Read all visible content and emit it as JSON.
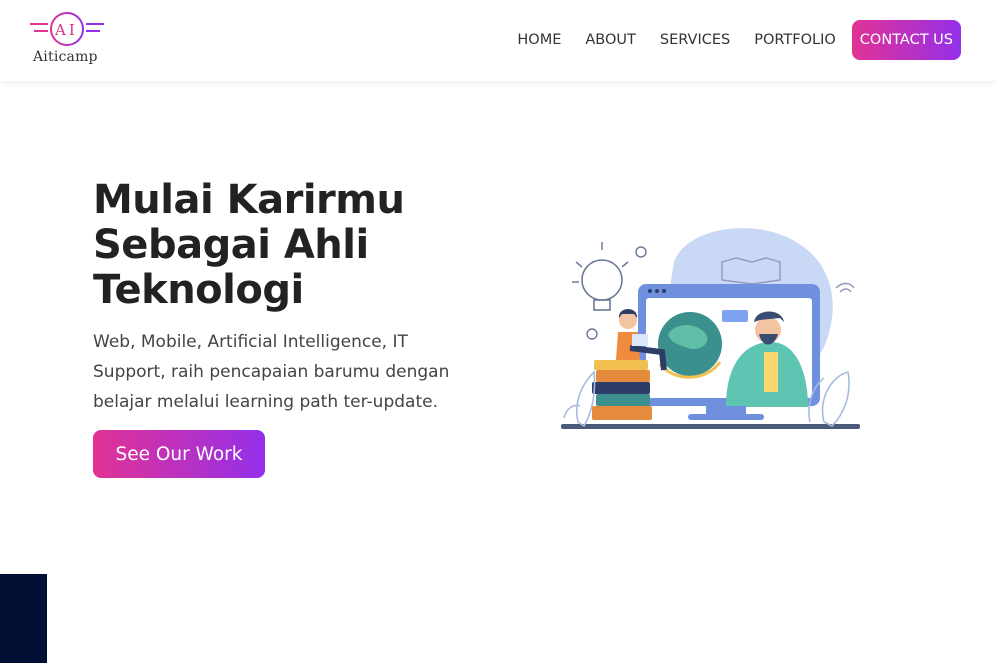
{
  "brand": {
    "monogram": "AI",
    "name": "Aiticamp",
    "colors": {
      "accent_start": "#e23294",
      "accent_end": "#9430ea"
    }
  },
  "nav": {
    "items": [
      {
        "label": "HOME"
      },
      {
        "label": "ABOUT"
      },
      {
        "label": "SERVICES"
      },
      {
        "label": "PORTFOLIO"
      }
    ],
    "cta_label": "CONTACT US"
  },
  "hero": {
    "title_line1": "Mulai Karirmu",
    "title_line2": "Sebagai Ahli",
    "title_line3": "Teknologi",
    "subtitle": "Web, Mobile, Artificial Intelligence, IT Support, raih pencapaian barumu dengan belajar melalui learning path ter-update.",
    "button_label": "See Our Work"
  },
  "illustration": {
    "icon": "online-learning-illustration"
  },
  "corner_block": {
    "color": "#020f35"
  }
}
